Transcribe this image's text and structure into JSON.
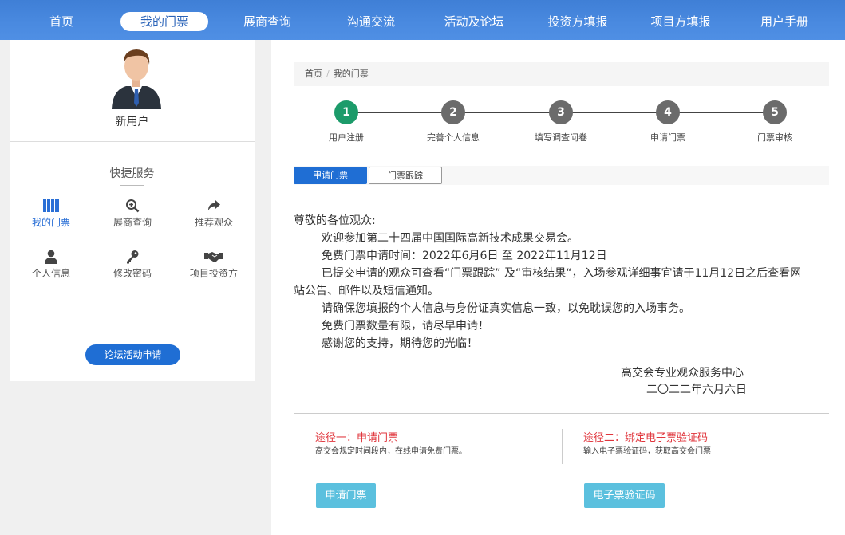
{
  "nav": {
    "items": [
      {
        "label": "首页"
      },
      {
        "label": "我的门票"
      },
      {
        "label": "展商查询"
      },
      {
        "label": "沟通交流"
      },
      {
        "label": "活动及论坛"
      },
      {
        "label": "投资方填报"
      },
      {
        "label": "项目方填报"
      },
      {
        "label": "用户手册"
      }
    ],
    "active_index": 1
  },
  "user": {
    "name": "新用户"
  },
  "quick_services": {
    "title": "快捷服务",
    "items": [
      {
        "label": "我的门票",
        "icon": "barcode-icon"
      },
      {
        "label": "展商查询",
        "icon": "search-plus-icon"
      },
      {
        "label": "推荐观众",
        "icon": "share-arrow-icon"
      },
      {
        "label": "个人信息",
        "icon": "user-icon"
      },
      {
        "label": "修改密码",
        "icon": "key-icon"
      },
      {
        "label": "项目投资方",
        "icon": "handshake-icon"
      }
    ],
    "forum_button": "论坛活动申请"
  },
  "breadcrumb": [
    "首页",
    "我的门票"
  ],
  "steps": [
    {
      "num": "1",
      "label": "用户注册"
    },
    {
      "num": "2",
      "label": "完善个人信息"
    },
    {
      "num": "3",
      "label": "填写调查问卷"
    },
    {
      "num": "4",
      "label": "申请门票"
    },
    {
      "num": "5",
      "label": "门票审核"
    }
  ],
  "current_step": 1,
  "tabs": [
    {
      "label": "申请门票"
    },
    {
      "label": "门票跟踪"
    }
  ],
  "notice": {
    "greeting": "尊敬的各位观众:",
    "lines": [
      "欢迎参加第二十四届中国国际高新技术成果交易会。",
      "免费门票申请时间：2022年6月6日 至 2022年11月12日",
      "已提交申请的观众可查看“门票跟踪” 及“审核结果“，入场参观详细事宜请于11月12日之后查看网站公告、邮件以及短信通知。",
      "请确保您填报的个人信息与身份证真实信息一致，以免耽误您的入场事务。",
      "免费门票数量有限，请尽早申请！",
      "感谢您的支持，期待您的光临！"
    ],
    "signature": "高交会专业观众服务中心",
    "date": "二〇二二年六月六日"
  },
  "routes": [
    {
      "title": "途径一：申请门票",
      "desc": "高交会规定时间段内，在线申请免费门票。",
      "button": "申请门票"
    },
    {
      "title": "途径二：绑定电子票验证码",
      "desc": "输入电子票验证码，获取高交会门票",
      "button": "电子票验证码"
    }
  ],
  "colors": {
    "nav_blue": "#4a8ae0",
    "primary_blue": "#1f6ed4",
    "step_active": "#1c9b6a",
    "step_inactive": "#6b6b6b",
    "route_title_red": "#e0353c",
    "route_button": "#5bc0de"
  }
}
